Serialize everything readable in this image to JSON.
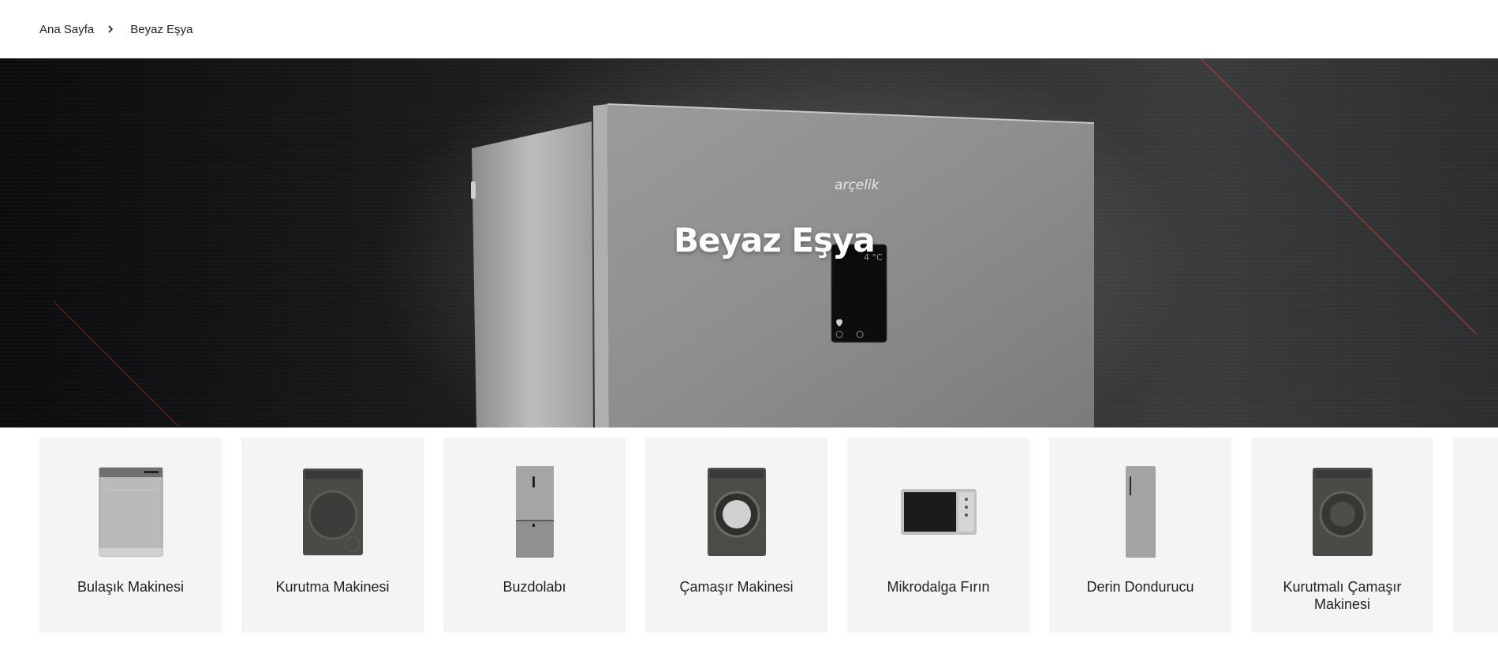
{
  "breadcrumb": {
    "home": "Ana Sayfa",
    "current": "Beyaz Eşya"
  },
  "hero": {
    "title": "Beyaz Eşya",
    "brand": "arçelik",
    "display_temp": "4 °C"
  },
  "categories": [
    {
      "label": "Bulaşık Makinesi",
      "icon": "dishwasher-icon"
    },
    {
      "label": "Kurutma Makinesi",
      "icon": "dryer-icon"
    },
    {
      "label": "Buzdolabı",
      "icon": "refrigerator-icon"
    },
    {
      "label": "Çamaşır Makinesi",
      "icon": "washing-machine-icon"
    },
    {
      "label": "Mikrodalga Fırın",
      "icon": "microwave-icon"
    },
    {
      "label": "Derin Dondurucu",
      "icon": "freezer-icon"
    },
    {
      "label": "Kurutmalı Çamaşır Makinesi",
      "icon": "washer-dryer-icon"
    }
  ],
  "colors": {
    "card_bg": "#f4f4f4",
    "hero_accent_line": "#c0392b"
  }
}
